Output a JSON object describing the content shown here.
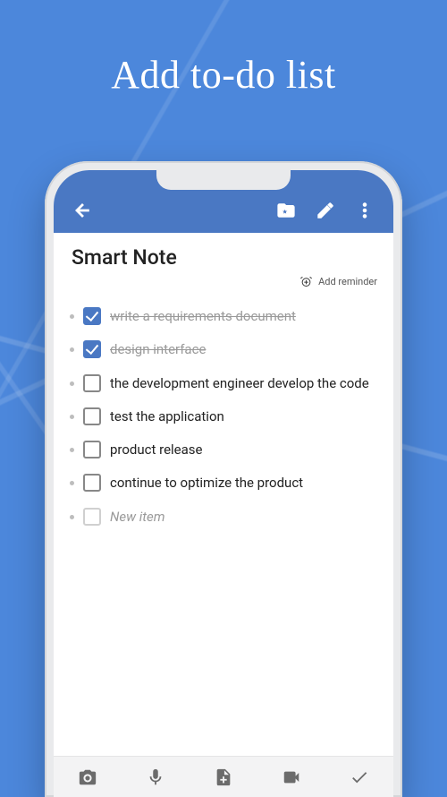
{
  "hero": {
    "title": "Add to-do list"
  },
  "appbar": {
    "back_label": "Back",
    "bookmark_label": "Bookmark",
    "edit_label": "Edit",
    "overflow_label": "More options"
  },
  "note": {
    "title": "Smart Note",
    "reminder_label": "Add reminder",
    "items": [
      {
        "text": "write a requirements document",
        "checked": true
      },
      {
        "text": "design interface",
        "checked": true
      },
      {
        "text": "the development engineer develop the code",
        "checked": false
      },
      {
        "text": "test the application",
        "checked": false
      },
      {
        "text": "product release",
        "checked": false
      },
      {
        "text": "continue to optimize the product",
        "checked": false
      }
    ],
    "new_item_placeholder": "New item"
  },
  "bottombar": {
    "camera": "Camera",
    "mic": "Voice",
    "attach": "Attach",
    "video": "Video",
    "done": "Done"
  },
  "colors": {
    "accent": "#4a78c3",
    "background": "#4c87db"
  }
}
